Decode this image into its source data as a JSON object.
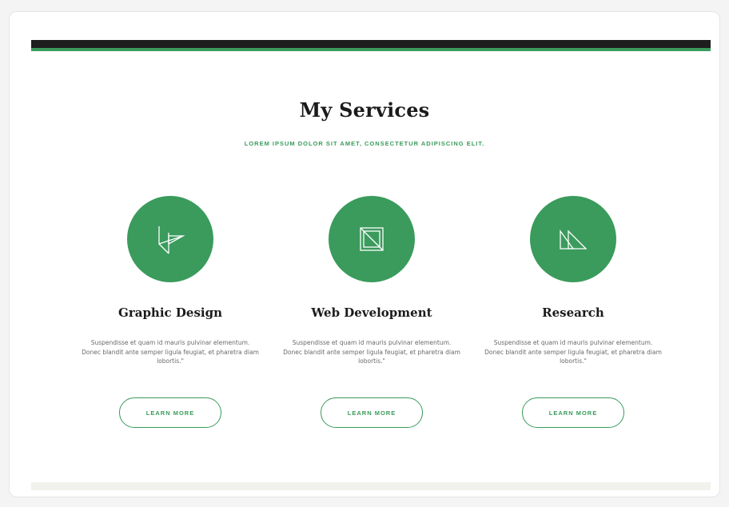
{
  "colors": {
    "accent": "#3a9b5c",
    "dark_bar": "#1e1e1e",
    "footer_band": "#f1f2ec"
  },
  "section": {
    "title": "My Services",
    "subtitle": "LOREM IPSUM DOLOR SIT AMET, CONSECTETUR ADIPISCING ELIT."
  },
  "services": [
    {
      "icon": "pen-tool-icon",
      "title": "Graphic Design",
      "body": "Suspendisse et quam id mauris pulvinar elementum. Donec blandit ante semper ligula feugiat, et pharetra diam lobortis.\"",
      "button_label": "LEARN MORE"
    },
    {
      "icon": "layout-frame-icon",
      "title": "Web Development",
      "body": "Suspendisse et quam id mauris pulvinar elementum. Donec blandit ante semper ligula feugiat, et pharetra diam lobortis.\"",
      "button_label": "LEARN MORE"
    },
    {
      "icon": "triangles-icon",
      "title": "Research",
      "body": "Suspendisse et quam id mauris pulvinar elementum. Donec blandit ante semper ligula feugiat, et pharetra diam lobortis.\"",
      "button_label": "LEARN MORE"
    }
  ]
}
